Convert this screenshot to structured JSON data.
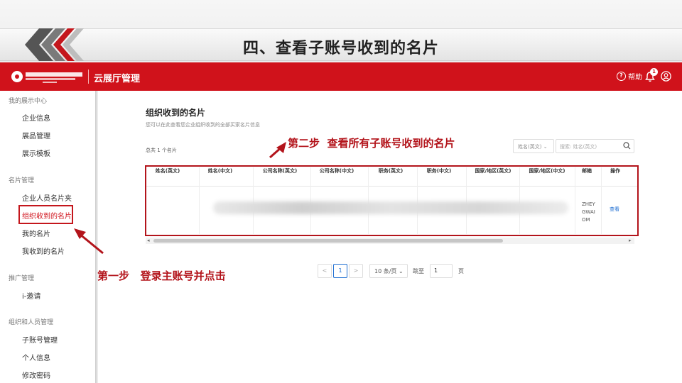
{
  "slide": {
    "title": "四、查看子账号收到的名片"
  },
  "header": {
    "app_name": "云展厅管理",
    "help_label": "帮助",
    "notification_count": "1",
    "brand_color": "#d0121b"
  },
  "sidebar": {
    "groups": [
      {
        "title": "我的展示中心",
        "items": [
          "企业信息",
          "展品管理",
          "展示模板"
        ]
      },
      {
        "title": "名片管理",
        "items": [
          "企业人员名片夹",
          "组织收到的名片",
          "我的名片",
          "我收到的名片"
        ]
      },
      {
        "title": "推广管理",
        "items": [
          "i-邀请"
        ]
      },
      {
        "title": "组织和人员管理",
        "items": [
          "子账号管理",
          "个人信息",
          "修改密码"
        ]
      }
    ],
    "active_item": "组织收到的名片"
  },
  "main": {
    "title": "组织收到的名片",
    "description": "您可以在此查看您企业组织收到的全部买家名片信息",
    "total": "总共 1 个名片",
    "filter_select": "姓名(英文)",
    "search_placeholder": "搜索: 姓名(英文)",
    "table": {
      "columns": [
        "姓名(英文)",
        "姓名(中文)",
        "公司名称(英文)",
        "公司名称(中文)",
        "职务(英文)",
        "职务(中文)",
        "国家/地区(英文)",
        "国家/地区(中文)",
        "邮箱",
        "操作"
      ],
      "rows": [
        {
          "email": "ZHEYGWAIOM",
          "email_lines": [
            "ZHEY",
            "GWAI",
            "OM"
          ],
          "action": "查看"
        }
      ]
    },
    "pagination": {
      "prev": "<",
      "current_page": "1",
      "next": ">",
      "page_size": "10 条/页",
      "jump_label": "跳至",
      "jump_value": "1",
      "page_suffix": "页"
    }
  },
  "annotations": {
    "step1": "第一步   登录主账号并点击",
    "step2": "第二步  查看所有子账号收到的名片"
  }
}
